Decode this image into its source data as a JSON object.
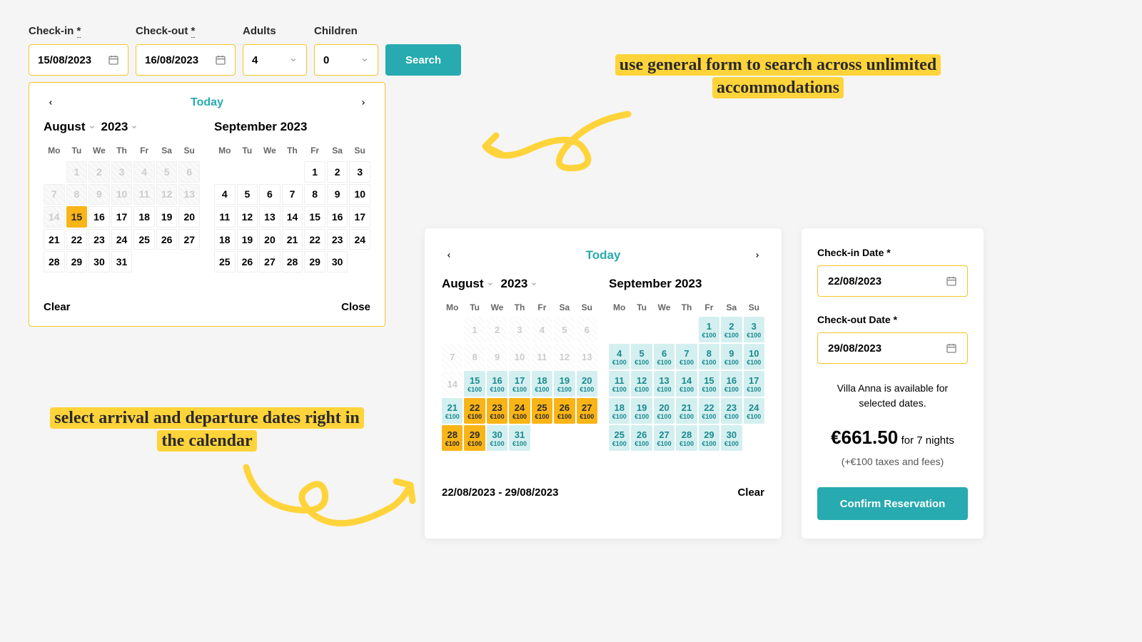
{
  "form": {
    "checkin_label": "Check-in",
    "checkout_label": "Check-out",
    "adults_label": "Adults",
    "children_label": "Children",
    "req_marker": "*",
    "checkin_value": "15/08/2023",
    "checkout_value": "16/08/2023",
    "adults_value": "4",
    "children_value": "0",
    "search_label": "Search"
  },
  "popup": {
    "today": "Today",
    "clear": "Clear",
    "close": "Close",
    "month1_name": "August",
    "month1_year": "2023",
    "month2_full": "September 2023",
    "weekdays": [
      "Mo",
      "Tu",
      "We",
      "Th",
      "Fr",
      "Sa",
      "Su"
    ],
    "aug_days": [
      {
        "n": "",
        "t": "empty"
      },
      {
        "n": 1,
        "t": "disabled"
      },
      {
        "n": 2,
        "t": "disabled"
      },
      {
        "n": 3,
        "t": "disabled"
      },
      {
        "n": 4,
        "t": "disabled"
      },
      {
        "n": 5,
        "t": "disabled"
      },
      {
        "n": 6,
        "t": "disabled"
      },
      {
        "n": 7,
        "t": "disabled"
      },
      {
        "n": 8,
        "t": "disabled"
      },
      {
        "n": 9,
        "t": "disabled"
      },
      {
        "n": 10,
        "t": "disabled"
      },
      {
        "n": 11,
        "t": "disabled"
      },
      {
        "n": 12,
        "t": "disabled"
      },
      {
        "n": 13,
        "t": "disabled"
      },
      {
        "n": 14,
        "t": "disabled"
      },
      {
        "n": 15,
        "t": "selected"
      },
      {
        "n": 16,
        "t": "normal"
      },
      {
        "n": 17,
        "t": "normal"
      },
      {
        "n": 18,
        "t": "normal"
      },
      {
        "n": 19,
        "t": "normal"
      },
      {
        "n": 20,
        "t": "normal"
      },
      {
        "n": 21,
        "t": "normal"
      },
      {
        "n": 22,
        "t": "normal"
      },
      {
        "n": 23,
        "t": "normal"
      },
      {
        "n": 24,
        "t": "normal"
      },
      {
        "n": 25,
        "t": "normal"
      },
      {
        "n": 26,
        "t": "normal"
      },
      {
        "n": 27,
        "t": "normal"
      },
      {
        "n": 28,
        "t": "normal"
      },
      {
        "n": 29,
        "t": "normal"
      },
      {
        "n": 30,
        "t": "normal"
      },
      {
        "n": 31,
        "t": "normal"
      }
    ],
    "sep_days": [
      {
        "n": "",
        "t": "empty"
      },
      {
        "n": "",
        "t": "empty"
      },
      {
        "n": "",
        "t": "empty"
      },
      {
        "n": "",
        "t": "empty"
      },
      {
        "n": 1,
        "t": "normal"
      },
      {
        "n": 2,
        "t": "normal"
      },
      {
        "n": 3,
        "t": "normal"
      },
      {
        "n": 4,
        "t": "normal"
      },
      {
        "n": 5,
        "t": "normal"
      },
      {
        "n": 6,
        "t": "normal"
      },
      {
        "n": 7,
        "t": "normal"
      },
      {
        "n": 8,
        "t": "normal"
      },
      {
        "n": 9,
        "t": "normal"
      },
      {
        "n": 10,
        "t": "normal"
      },
      {
        "n": 11,
        "t": "normal"
      },
      {
        "n": 12,
        "t": "normal"
      },
      {
        "n": 13,
        "t": "normal"
      },
      {
        "n": 14,
        "t": "normal"
      },
      {
        "n": 15,
        "t": "normal"
      },
      {
        "n": 16,
        "t": "normal"
      },
      {
        "n": 17,
        "t": "normal"
      },
      {
        "n": 18,
        "t": "normal"
      },
      {
        "n": 19,
        "t": "normal"
      },
      {
        "n": 20,
        "t": "normal"
      },
      {
        "n": 21,
        "t": "normal"
      },
      {
        "n": 22,
        "t": "normal"
      },
      {
        "n": 23,
        "t": "normal"
      },
      {
        "n": 24,
        "t": "normal"
      },
      {
        "n": 25,
        "t": "normal"
      },
      {
        "n": 26,
        "t": "normal"
      },
      {
        "n": 27,
        "t": "normal"
      },
      {
        "n": 28,
        "t": "normal"
      },
      {
        "n": 29,
        "t": "normal"
      },
      {
        "n": 30,
        "t": "normal"
      }
    ]
  },
  "annotation1": "use general form to search across unlimited accommodations",
  "annotation2": "select arrival and departure dates right in the calendar",
  "booking_cal": {
    "today": "Today",
    "month1_name": "August",
    "month1_year": "2023",
    "month2_full": "September 2023",
    "weekdays": [
      "Mo",
      "Tu",
      "We",
      "Th",
      "Fr",
      "Sa",
      "Su"
    ],
    "price_label": "€100",
    "aug": [
      {
        "n": "",
        "t": "empty"
      },
      {
        "n": 1,
        "t": "past"
      },
      {
        "n": 2,
        "t": "past"
      },
      {
        "n": 3,
        "t": "past"
      },
      {
        "n": 4,
        "t": "past"
      },
      {
        "n": 5,
        "t": "past"
      },
      {
        "n": 6,
        "t": "past"
      },
      {
        "n": 7,
        "t": "past"
      },
      {
        "n": 8,
        "t": "past"
      },
      {
        "n": 9,
        "t": "past"
      },
      {
        "n": 10,
        "t": "past"
      },
      {
        "n": 11,
        "t": "past"
      },
      {
        "n": 12,
        "t": "past"
      },
      {
        "n": 13,
        "t": "past"
      },
      {
        "n": 14,
        "t": "past"
      },
      {
        "n": 15,
        "t": "avail"
      },
      {
        "n": 16,
        "t": "avail"
      },
      {
        "n": 17,
        "t": "avail"
      },
      {
        "n": 18,
        "t": "avail"
      },
      {
        "n": 19,
        "t": "avail"
      },
      {
        "n": 20,
        "t": "avail"
      },
      {
        "n": 21,
        "t": "avail"
      },
      {
        "n": 22,
        "t": "range"
      },
      {
        "n": 23,
        "t": "range"
      },
      {
        "n": 24,
        "t": "range"
      },
      {
        "n": 25,
        "t": "range"
      },
      {
        "n": 26,
        "t": "range"
      },
      {
        "n": 27,
        "t": "range"
      },
      {
        "n": 28,
        "t": "range"
      },
      {
        "n": 29,
        "t": "range"
      },
      {
        "n": 30,
        "t": "avail"
      },
      {
        "n": 31,
        "t": "avail"
      }
    ],
    "sep": [
      {
        "n": "",
        "t": "empty"
      },
      {
        "n": "",
        "t": "empty"
      },
      {
        "n": "",
        "t": "empty"
      },
      {
        "n": "",
        "t": "empty"
      },
      {
        "n": 1,
        "t": "avail"
      },
      {
        "n": 2,
        "t": "avail"
      },
      {
        "n": 3,
        "t": "avail"
      },
      {
        "n": 4,
        "t": "avail"
      },
      {
        "n": 5,
        "t": "avail"
      },
      {
        "n": 6,
        "t": "avail"
      },
      {
        "n": 7,
        "t": "avail"
      },
      {
        "n": 8,
        "t": "avail"
      },
      {
        "n": 9,
        "t": "avail"
      },
      {
        "n": 10,
        "t": "avail"
      },
      {
        "n": 11,
        "t": "avail"
      },
      {
        "n": 12,
        "t": "avail"
      },
      {
        "n": 13,
        "t": "avail"
      },
      {
        "n": 14,
        "t": "avail"
      },
      {
        "n": 15,
        "t": "avail"
      },
      {
        "n": 16,
        "t": "avail"
      },
      {
        "n": 17,
        "t": "avail"
      },
      {
        "n": 18,
        "t": "avail"
      },
      {
        "n": 19,
        "t": "avail"
      },
      {
        "n": 20,
        "t": "avail"
      },
      {
        "n": 21,
        "t": "avail"
      },
      {
        "n": 22,
        "t": "avail"
      },
      {
        "n": 23,
        "t": "avail"
      },
      {
        "n": 24,
        "t": "avail"
      },
      {
        "n": 25,
        "t": "avail"
      },
      {
        "n": 26,
        "t": "avail"
      },
      {
        "n": 27,
        "t": "avail"
      },
      {
        "n": 28,
        "t": "avail"
      },
      {
        "n": 29,
        "t": "avail"
      },
      {
        "n": 30,
        "t": "avail"
      }
    ],
    "range_text": "22/08/2023 - 29/08/2023",
    "clear": "Clear"
  },
  "sidebar": {
    "checkin_label": "Check-in Date *",
    "checkin_value": "22/08/2023",
    "checkout_label": "Check-out Date *",
    "checkout_value": "29/08/2023",
    "avail_text": "Villa Anna is available for selected dates.",
    "price": "€661.50",
    "nights_text": "for 7 nights",
    "tax_text": "(+€100 taxes and fees)",
    "confirm": "Confirm Reservation"
  }
}
